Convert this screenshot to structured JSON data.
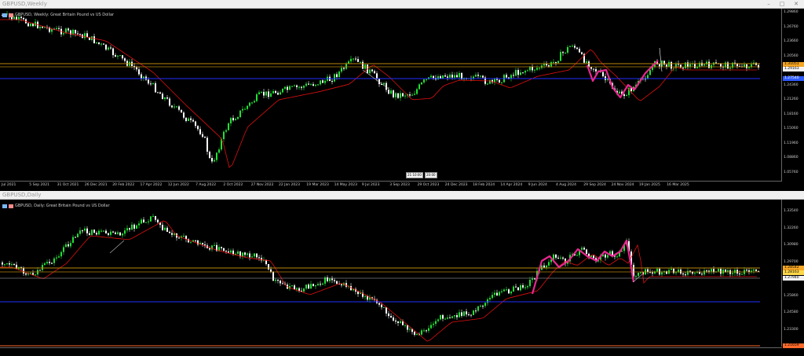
{
  "top": {
    "window_title": "GBPUSD,Weekly",
    "symbol_label": "GBPUSD, Weekly:  Great Britain Pound vs US Dollar",
    "price_labels": [
      "1.29860",
      "1.26760",
      "1.23660",
      "1.20560",
      "1.27540",
      "1.24360",
      "1.21260",
      "1.18160",
      "1.15060",
      "1.11960",
      "1.08860",
      "1.05760"
    ],
    "price_tags": [
      {
        "text": "1.31051",
        "color": "#f5a623"
      },
      {
        "text": "1.29163",
        "color": "#f3f3f3"
      },
      {
        "text": "1.27540",
        "color": "#2e5bff"
      }
    ],
    "time_labels": [
      "Jul 2021",
      "5 Sep 2021",
      "31 Oct 2021",
      "26 Dec 2021",
      "20 Feb 2022",
      "17 Apr 2022",
      "12 Jun 2022",
      "7 Aug 2022",
      "2 Oct 2022",
      "27 Nov 2022",
      "22 Jan 2023",
      "19 Mar 2023",
      "14 May 2023",
      "9 Jul 2023",
      "3 Sep 2023",
      "29 Oct 2023",
      "24 Dec 2023",
      "18 Feb 2024",
      "14 Apr 2024",
      "9 Jun 2024",
      "4 Aug 2024",
      "29 Sep 2024",
      "24 Nov 2024",
      "19 Jan 2025",
      "16 Mar 2025"
    ],
    "flags": [
      "21:10:00",
      "20:00"
    ]
  },
  "bottom": {
    "window_title": "GBPUSD,Daily",
    "symbol_label": "GBPUSD, Daily:  Great Britain Pound vs US Dollar",
    "price_labels": [
      "1.33540",
      "1.32260",
      "1.30980",
      "1.29700",
      "1.27140",
      "1.25860",
      "1.24580",
      "1.23300",
      "1.22020"
    ],
    "price_tags": [
      {
        "text": "1.28542",
        "color": "#f5a623"
      },
      {
        "text": "1.28163",
        "color": "#ffd84a"
      },
      {
        "text": "1.27940",
        "color": "#f3f3f3"
      },
      {
        "text": "1.21659",
        "color": "#ff6a2b"
      }
    ]
  },
  "colors": {
    "bull": "#22e035",
    "bear": "#ffffff",
    "ma": "#e01010",
    "gold": "#b8860b",
    "blue": "#1f2eff",
    "pattern": "#e8288f"
  },
  "icons": {
    "minimize": "minimize-icon",
    "maximize": "maximize-icon",
    "close": "close-icon"
  }
}
